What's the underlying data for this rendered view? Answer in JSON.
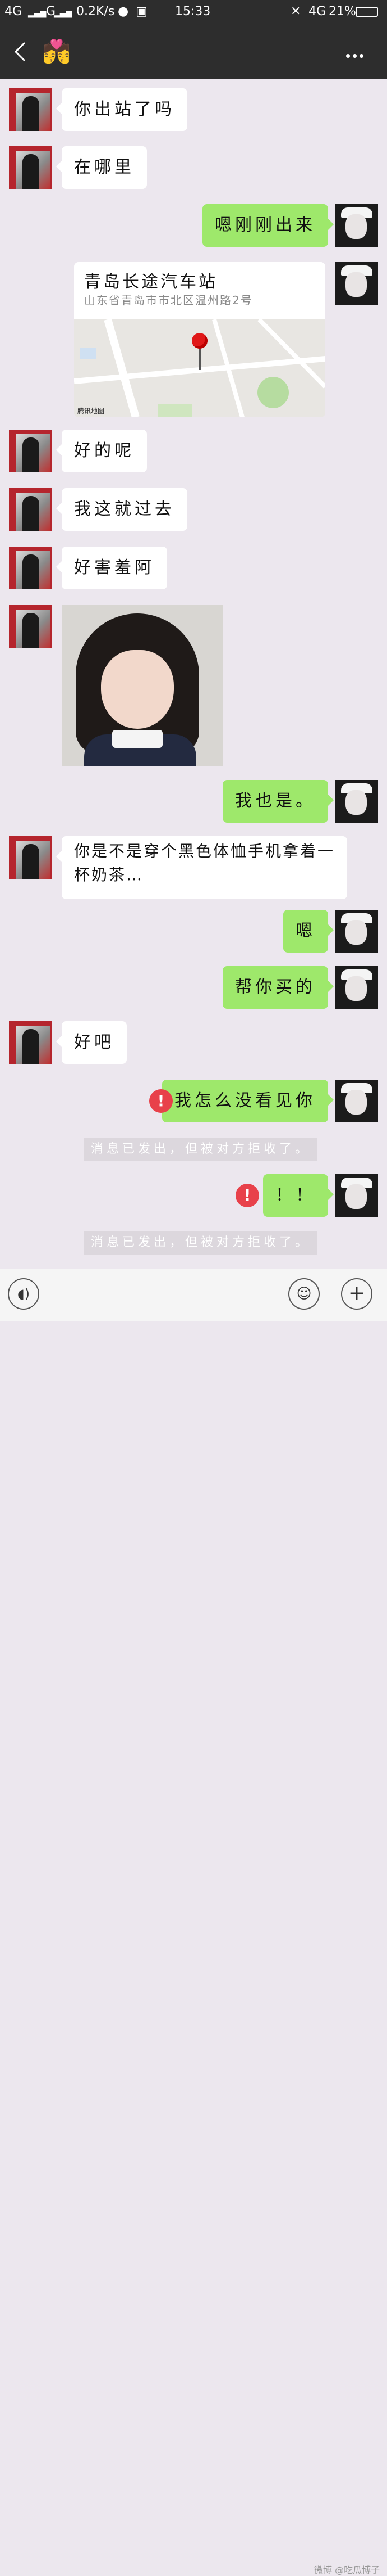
{
  "status_bar": {
    "signal_left": "4G",
    "signal_mid": "G",
    "speed": "0.2K/s",
    "time": "15:33",
    "network_right": "4G",
    "battery": "21%"
  },
  "header": {
    "title_emoji": "💏",
    "back_icon": "chevron-left-icon",
    "more_icon": "more-dots-icon"
  },
  "messages": [
    {
      "side": "left",
      "text": "你出站了吗"
    },
    {
      "side": "left",
      "text": "在哪里"
    },
    {
      "side": "right",
      "text": "嗯刚刚出来"
    },
    {
      "side": "right",
      "type": "location",
      "title": "青岛长途汽车站",
      "address": "山东省青岛市市北区温州路2号",
      "map_credit": "腾讯地图"
    },
    {
      "side": "left",
      "text": "好的呢"
    },
    {
      "side": "left",
      "text": "我这就过去"
    },
    {
      "side": "left",
      "text": "好害羞阿"
    },
    {
      "side": "left",
      "type": "image"
    },
    {
      "side": "right",
      "text": "我也是。"
    },
    {
      "side": "left",
      "line1": "你是不是穿个黑色体恤手机拿着一",
      "line2": "杯奶茶…"
    },
    {
      "side": "right",
      "text": "嗯"
    },
    {
      "side": "right",
      "text": "帮你买的"
    },
    {
      "side": "left",
      "text": "好吧"
    },
    {
      "side": "right",
      "text": "我怎么没看见你",
      "failed": true
    },
    {
      "side": "system",
      "text": "消息已发出，但被对方拒收了。"
    },
    {
      "side": "right",
      "text": "！！",
      "failed": true
    },
    {
      "side": "system",
      "text": "消息已发出，但被对方拒收了。"
    }
  ],
  "warning_glyph": "!",
  "bottom_bar": {
    "voice_icon": "voice-icon",
    "emoji_icon": "emoji-icon",
    "plus_icon": "plus-icon",
    "plus_glyph": "+",
    "watermark": "微博 @吃瓜博子"
  }
}
